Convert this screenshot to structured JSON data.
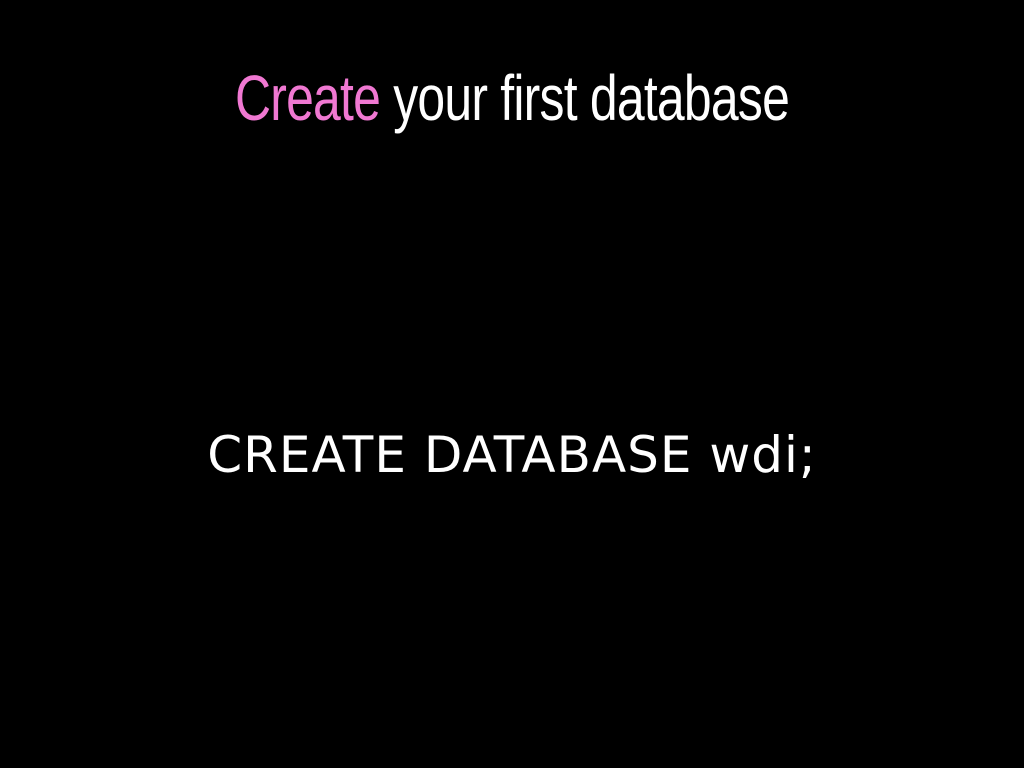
{
  "slide": {
    "title_accent": "Create",
    "title_rest": " your first database",
    "code": "CREATE DATABASE wdi;"
  },
  "colors": {
    "background": "#000000",
    "accent": "#f078d2",
    "text": "#ffffff"
  }
}
